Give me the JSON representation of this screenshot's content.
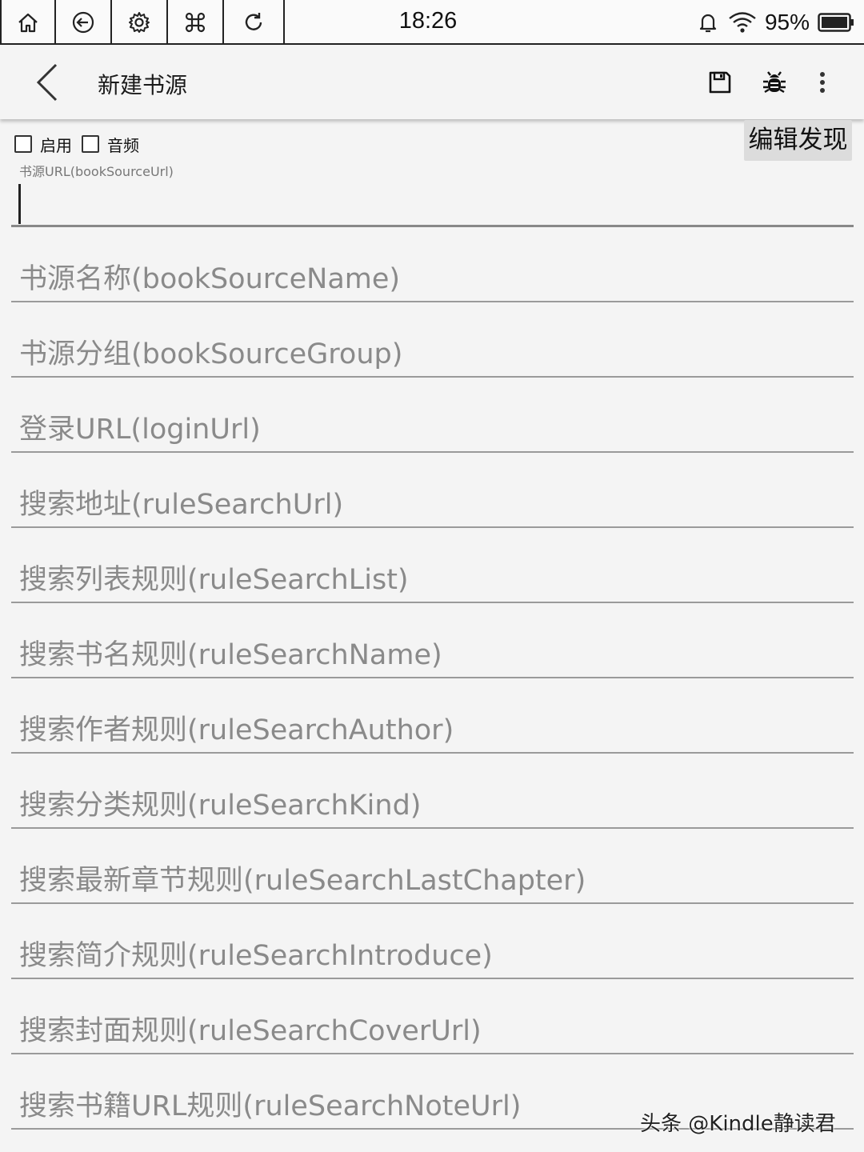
{
  "status_bar": {
    "system_buttons": [
      "home-icon",
      "back-circle-icon",
      "settings-icon",
      "command-icon",
      "refresh-icon"
    ],
    "time": "18:26",
    "battery": "95%"
  },
  "toolbar": {
    "title": "新建书源",
    "icons": [
      "save-icon",
      "bug-icon",
      "more-vert-icon"
    ]
  },
  "options": {
    "enable_label": "启用",
    "audio_label": "音频",
    "enable_checked": false,
    "audio_checked": false,
    "edit_discover_label": "编辑发现"
  },
  "url_field": {
    "label": "书源URL(bookSourceUrl)",
    "value": ""
  },
  "fields": [
    {
      "placeholder": "书源名称(bookSourceName)"
    },
    {
      "placeholder": "书源分组(bookSourceGroup)"
    },
    {
      "placeholder": "登录URL(loginUrl)"
    },
    {
      "placeholder": "搜索地址(ruleSearchUrl)"
    },
    {
      "placeholder": "搜索列表规则(ruleSearchList)"
    },
    {
      "placeholder": "搜索书名规则(ruleSearchName)"
    },
    {
      "placeholder": "搜索作者规则(ruleSearchAuthor)"
    },
    {
      "placeholder": "搜索分类规则(ruleSearchKind)"
    },
    {
      "placeholder": "搜索最新章节规则(ruleSearchLastChapter)"
    },
    {
      "placeholder": "搜索简介规则(ruleSearchIntroduce)"
    },
    {
      "placeholder": "搜索封面规则(ruleSearchCoverUrl)"
    },
    {
      "placeholder": "搜索书籍URL规则(ruleSearchNoteUrl)"
    }
  ],
  "watermark": "头条 @Kindle静读君"
}
